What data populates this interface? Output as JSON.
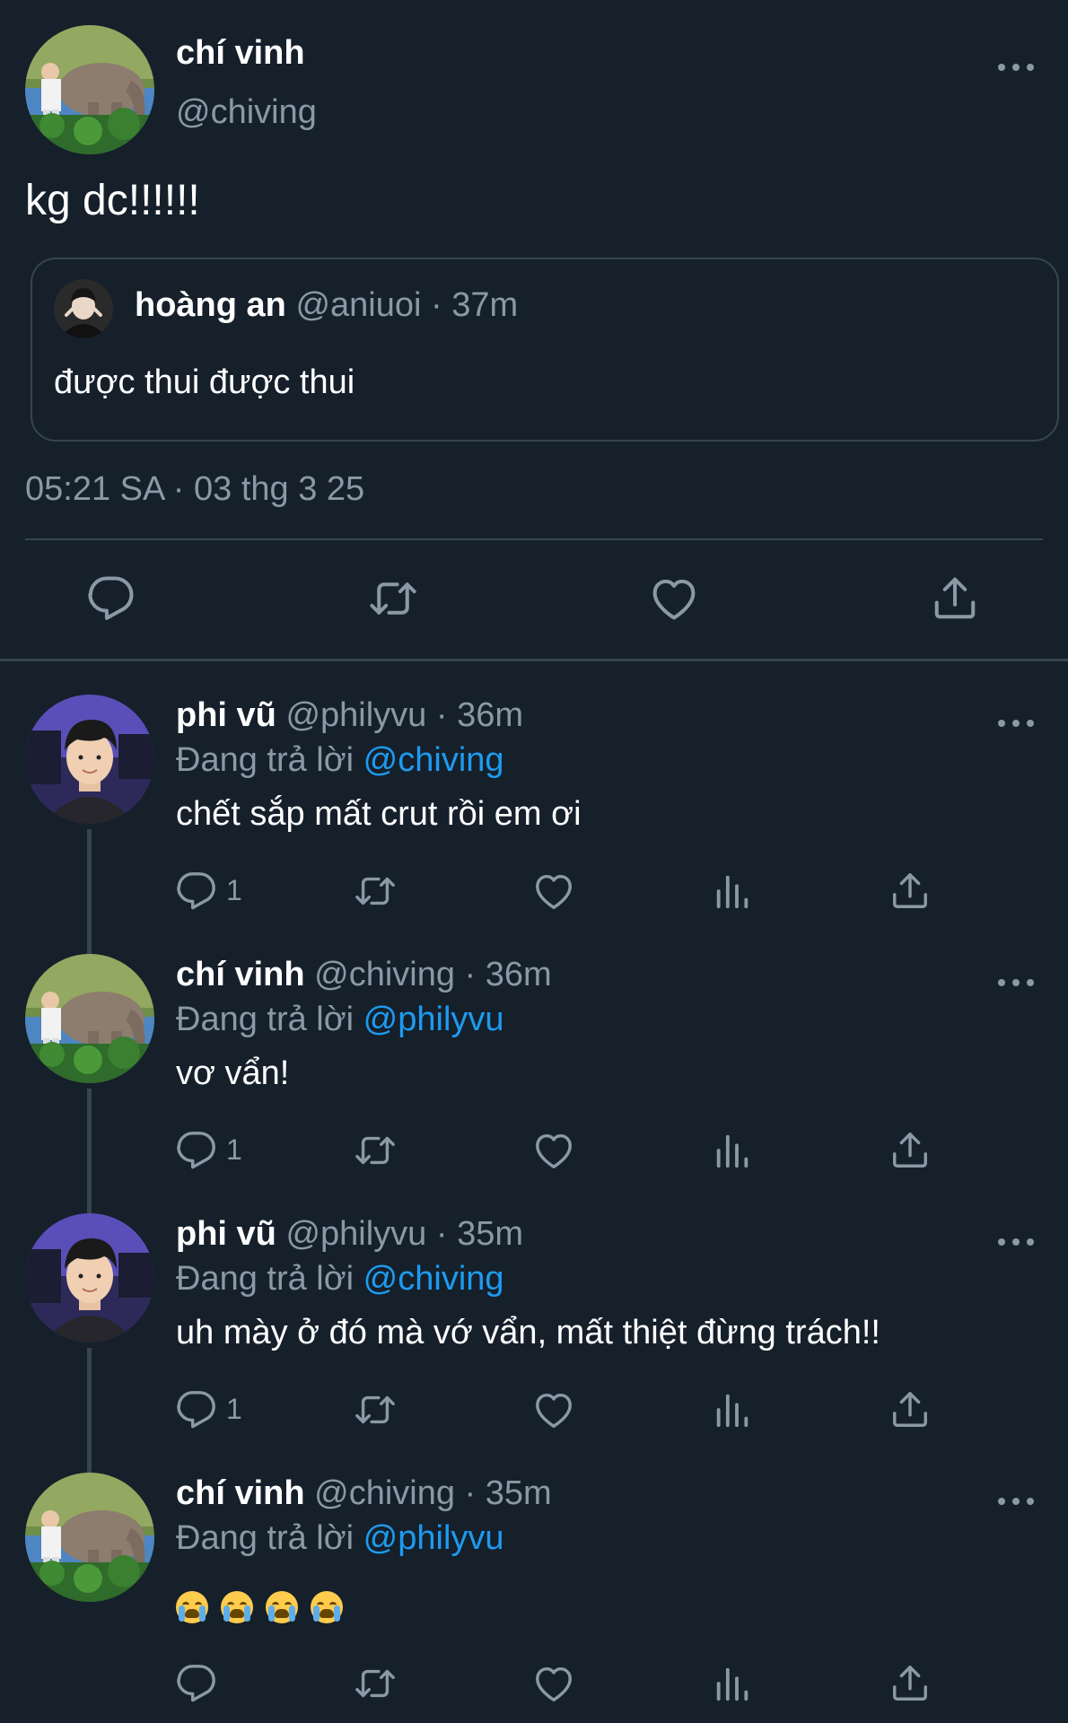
{
  "main_tweet": {
    "author_name": "chí vinh",
    "author_handle": "@chiving",
    "text": "kg dc!!!!!!",
    "quoted": {
      "author_name": "hoàng an",
      "meta": "@aniuoi · 37m",
      "text": "được thui được thui"
    },
    "timestamp": "05:21 SA · 03 thg 3 25",
    "actions": [
      "reply-icon",
      "retweet-icon",
      "like-icon",
      "share-icon"
    ]
  },
  "replying_label": "Đang trả lời",
  "replies": [
    {
      "name": "phi vũ",
      "meta": "@philyvu · 36m",
      "replying_to": "@chiving",
      "text": "chết sắp mất crut rồi em ơi",
      "reply_count": "1"
    },
    {
      "name": "chí vinh",
      "meta": "@chiving · 36m",
      "replying_to": "@philyvu",
      "text": "vơ vẩn!",
      "reply_count": "1"
    },
    {
      "name": "phi vũ",
      "meta": "@philyvu · 35m",
      "replying_to": "@chiving",
      "text": "uh mày ở đó mà vớ vẩn, mất thiệt đừng trách!!",
      "reply_count": "1"
    },
    {
      "name": "chí vinh",
      "meta": "@chiving · 35m",
      "replying_to": "@philyvu",
      "text": "😭 😭 😭 😭",
      "reply_count": ""
    }
  ],
  "colors": {
    "background": "#15202b",
    "muted": "#8b98a5",
    "link": "#1d9bf0",
    "border": "#38444d"
  }
}
